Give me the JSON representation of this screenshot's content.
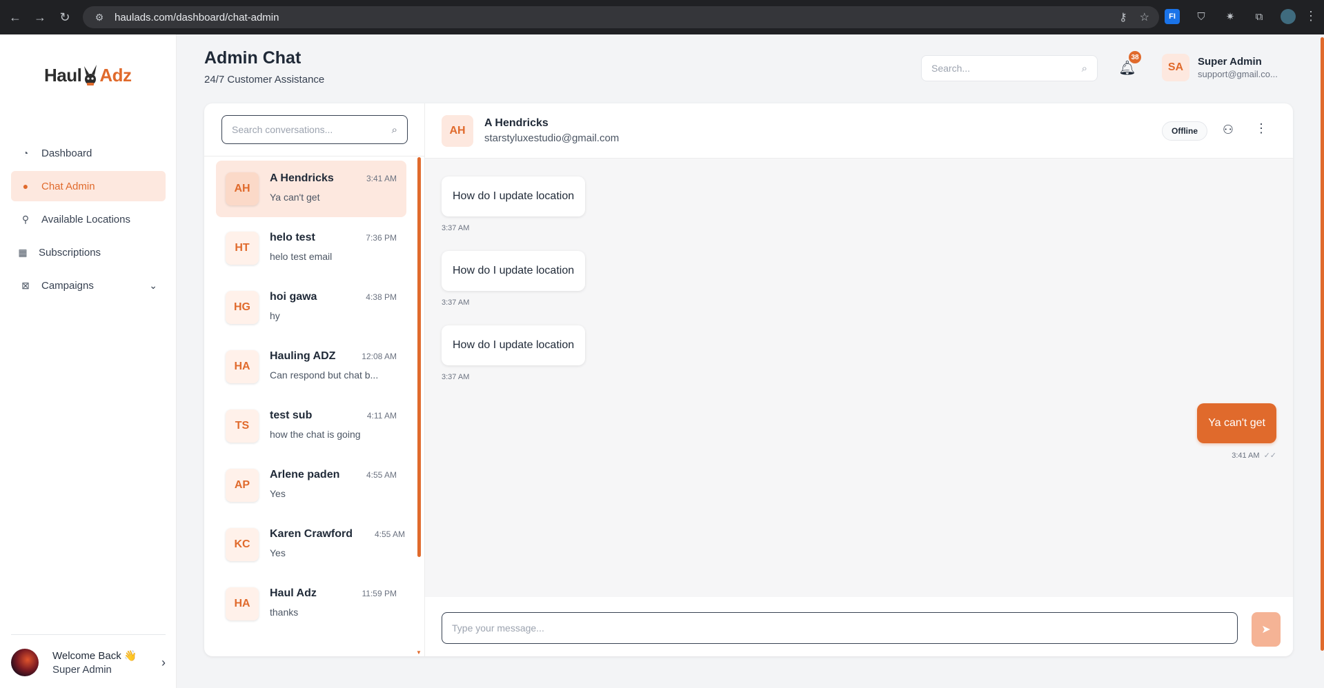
{
  "browser": {
    "url": "haulads.com/dashboard/chat-admin",
    "back_icon": "arrow-left-icon",
    "forward_icon": "arrow-right-icon",
    "reload_icon": "reload-icon",
    "ext_badge": "FI"
  },
  "sidebar": {
    "logo": {
      "left": "Haul",
      "right": "Adz"
    },
    "items": [
      {
        "label": "Dashboard",
        "icon": "pie-chart-icon",
        "active": false
      },
      {
        "label": "Chat Admin",
        "icon": "chat-icon",
        "active": true
      },
      {
        "label": "Available Locations",
        "icon": "location-pin-icon",
        "active": false
      },
      {
        "label": "Subscriptions",
        "icon": "subscriptions-icon",
        "active": false
      },
      {
        "label": "Campaigns",
        "icon": "campaign-icon",
        "active": false,
        "has_children": true
      }
    ],
    "footer": {
      "greeting": "Welcome Back 👋",
      "role": "Super Admin"
    }
  },
  "header": {
    "title": "Admin Chat",
    "subtitle": "24/7 Customer Assistance",
    "search_placeholder": "Search...",
    "notification_count": "38",
    "user": {
      "initials": "SA",
      "name": "Super Admin",
      "email": "support@gmail.co..."
    }
  },
  "conversations": {
    "search_placeholder": "Search conversations...",
    "items": [
      {
        "initials": "AH",
        "name": "A Hendricks",
        "time": "3:41 AM",
        "preview": "Ya can't get",
        "active": true
      },
      {
        "initials": "HT",
        "name": "helo test",
        "time": "7:36 PM",
        "preview": "helo test email",
        "active": false
      },
      {
        "initials": "HG",
        "name": "hoi gawa",
        "time": "4:38 PM",
        "preview": "hy",
        "active": false
      },
      {
        "initials": "HA",
        "name": "Hauling ADZ",
        "time": "12:08 AM",
        "preview": "Can respond but chat b...",
        "active": false
      },
      {
        "initials": "TS",
        "name": "test sub",
        "time": "4:11 AM",
        "preview": "how the chat is going",
        "active": false
      },
      {
        "initials": "AP",
        "name": "Arlene paden",
        "time": "4:55 AM",
        "preview": "Yes",
        "active": false
      },
      {
        "initials": "KC",
        "name": "Karen Crawford",
        "time": "4:55 AM",
        "preview": "Yes",
        "active": false
      },
      {
        "initials": "HA",
        "name": "Haul Adz",
        "time": "11:59 PM",
        "preview": "thanks",
        "active": false
      }
    ]
  },
  "chat": {
    "contact": {
      "initials": "AH",
      "name": "A Hendricks",
      "email": "starstyluxestudio@gmail.com",
      "status": "Offline"
    },
    "incoming": [
      {
        "text": "How do I update location",
        "time": "3:37 AM"
      },
      {
        "text": "How do I update location",
        "time": "3:37 AM"
      },
      {
        "text": "How do I update location",
        "time": "3:37 AM"
      }
    ],
    "outgoing": {
      "text": "Ya can't get",
      "time": "3:41 AM"
    },
    "input_placeholder": "Type your message..."
  },
  "colors": {
    "accent": "#e06a2c",
    "accent_light": "#fde8df",
    "send_disabled": "#f5b395"
  }
}
